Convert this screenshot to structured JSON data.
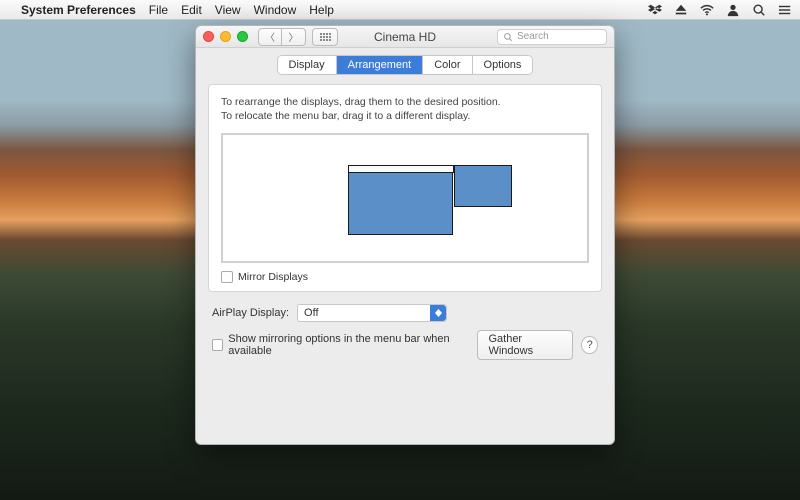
{
  "menubar": {
    "app_name": "System Preferences",
    "items": [
      "File",
      "Edit",
      "View",
      "Window",
      "Help"
    ]
  },
  "window": {
    "title": "Cinema HD",
    "search_placeholder": "Search",
    "tabs": {
      "display": "Display",
      "arrangement": "Arrangement",
      "color": "Color",
      "options": "Options"
    },
    "hint_line1": "To rearrange the displays, drag them to the desired position.",
    "hint_line2": "To relocate the menu bar, drag it to a different display.",
    "mirror_label": "Mirror Displays",
    "airplay_label": "AirPlay Display:",
    "airplay_value": "Off",
    "show_mirror_label": "Show mirroring options in the menu bar when available",
    "gather_label": "Gather Windows",
    "help_label": "?"
  }
}
